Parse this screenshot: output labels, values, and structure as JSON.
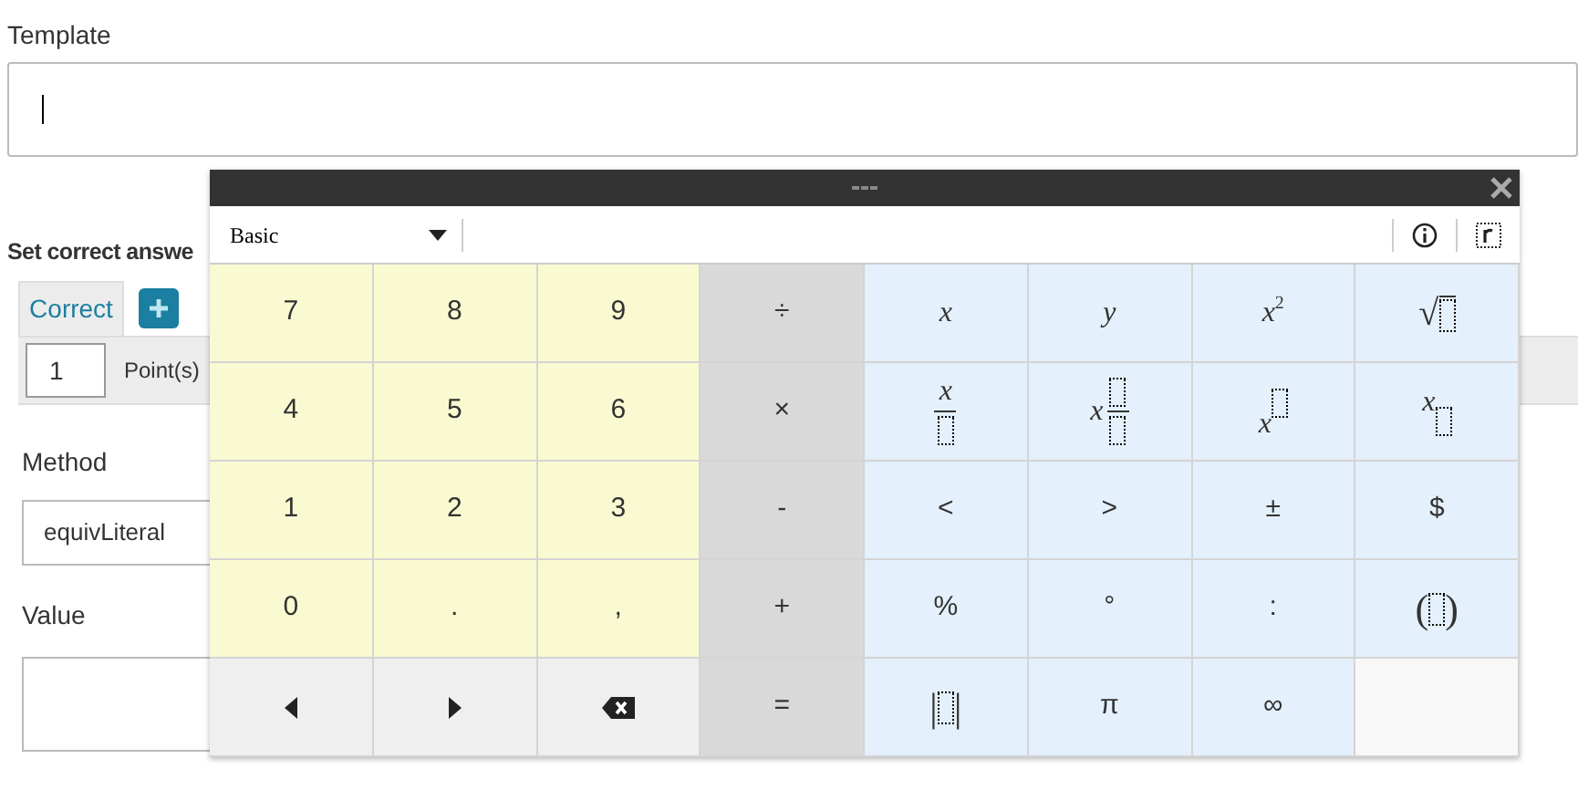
{
  "template": {
    "label": "Template",
    "focused": true
  },
  "correct_answers": {
    "heading": "Set correct answe",
    "tabs": [
      {
        "label": "Correct",
        "selected": true
      }
    ],
    "points": {
      "value": "1",
      "label": "Point(s)"
    },
    "method": {
      "label": "Method",
      "value": "equivLiteral"
    },
    "value": {
      "label": "Value"
    }
  },
  "keyboard": {
    "mode": "Basic",
    "keys": [
      {
        "color": "#fafad2",
        "kind": "text",
        "label": "7"
      },
      {
        "color": "#fafad2",
        "kind": "text",
        "label": "8"
      },
      {
        "color": "#fafad2",
        "kind": "text",
        "label": "9"
      },
      {
        "color": "#d9d9d9",
        "kind": "text",
        "label": "÷"
      },
      {
        "color": "#e4f0fb",
        "kind": "math",
        "label": "x"
      },
      {
        "color": "#e4f0fb",
        "kind": "math",
        "label": "y"
      },
      {
        "color": "#e4f0fb",
        "kind": "sup",
        "label": "x",
        "sup": "2"
      },
      {
        "color": "#e4f0fb",
        "kind": "sqrt",
        "label": "√"
      },
      {
        "color": "#fafad2",
        "kind": "text",
        "label": "4"
      },
      {
        "color": "#fafad2",
        "kind": "text",
        "label": "5"
      },
      {
        "color": "#fafad2",
        "kind": "text",
        "label": "6"
      },
      {
        "color": "#d9d9d9",
        "kind": "text",
        "label": "×"
      },
      {
        "color": "#e4f0fb",
        "kind": "frac",
        "label": "x"
      },
      {
        "color": "#e4f0fb",
        "kind": "mixed",
        "label": "x"
      },
      {
        "color": "#e4f0fb",
        "kind": "sup_box",
        "label": "x"
      },
      {
        "color": "#e4f0fb",
        "kind": "sub_box",
        "label": "x"
      },
      {
        "color": "#fafad2",
        "kind": "text",
        "label": "1"
      },
      {
        "color": "#fafad2",
        "kind": "text",
        "label": "2"
      },
      {
        "color": "#fafad2",
        "kind": "text",
        "label": "3"
      },
      {
        "color": "#d9d9d9",
        "kind": "text",
        "label": "-"
      },
      {
        "color": "#e4f0fb",
        "kind": "text",
        "label": "<"
      },
      {
        "color": "#e4f0fb",
        "kind": "text",
        "label": ">"
      },
      {
        "color": "#e4f0fb",
        "kind": "text",
        "label": "±"
      },
      {
        "color": "#e4f0fb",
        "kind": "text",
        "label": "$"
      },
      {
        "color": "#fafad2",
        "kind": "text",
        "label": "0"
      },
      {
        "color": "#fafad2",
        "kind": "text",
        "label": "."
      },
      {
        "color": "#fafad2",
        "kind": "text",
        "label": ","
      },
      {
        "color": "#d9d9d9",
        "kind": "text",
        "label": "+"
      },
      {
        "color": "#e4f0fb",
        "kind": "text",
        "label": "%"
      },
      {
        "color": "#e4f0fb",
        "kind": "text",
        "label": "°"
      },
      {
        "color": "#e4f0fb",
        "kind": "text",
        "label": ":"
      },
      {
        "color": "#e4f0fb",
        "kind": "paren",
        "label": "(",
        "close": ")"
      },
      {
        "color": "#efefef",
        "kind": "left"
      },
      {
        "color": "#efefef",
        "kind": "right"
      },
      {
        "color": "#efefef",
        "kind": "backspace"
      },
      {
        "color": "#d9d9d9",
        "kind": "text",
        "label": "="
      },
      {
        "color": "#e4f0fb",
        "kind": "abs",
        "label": "|",
        "close": "|"
      },
      {
        "color": "#e4f0fb",
        "kind": "text",
        "label": "π"
      },
      {
        "color": "#e4f0fb",
        "kind": "text",
        "label": "∞"
      },
      {
        "color": "#f8f8f8",
        "kind": "empty"
      }
    ]
  }
}
